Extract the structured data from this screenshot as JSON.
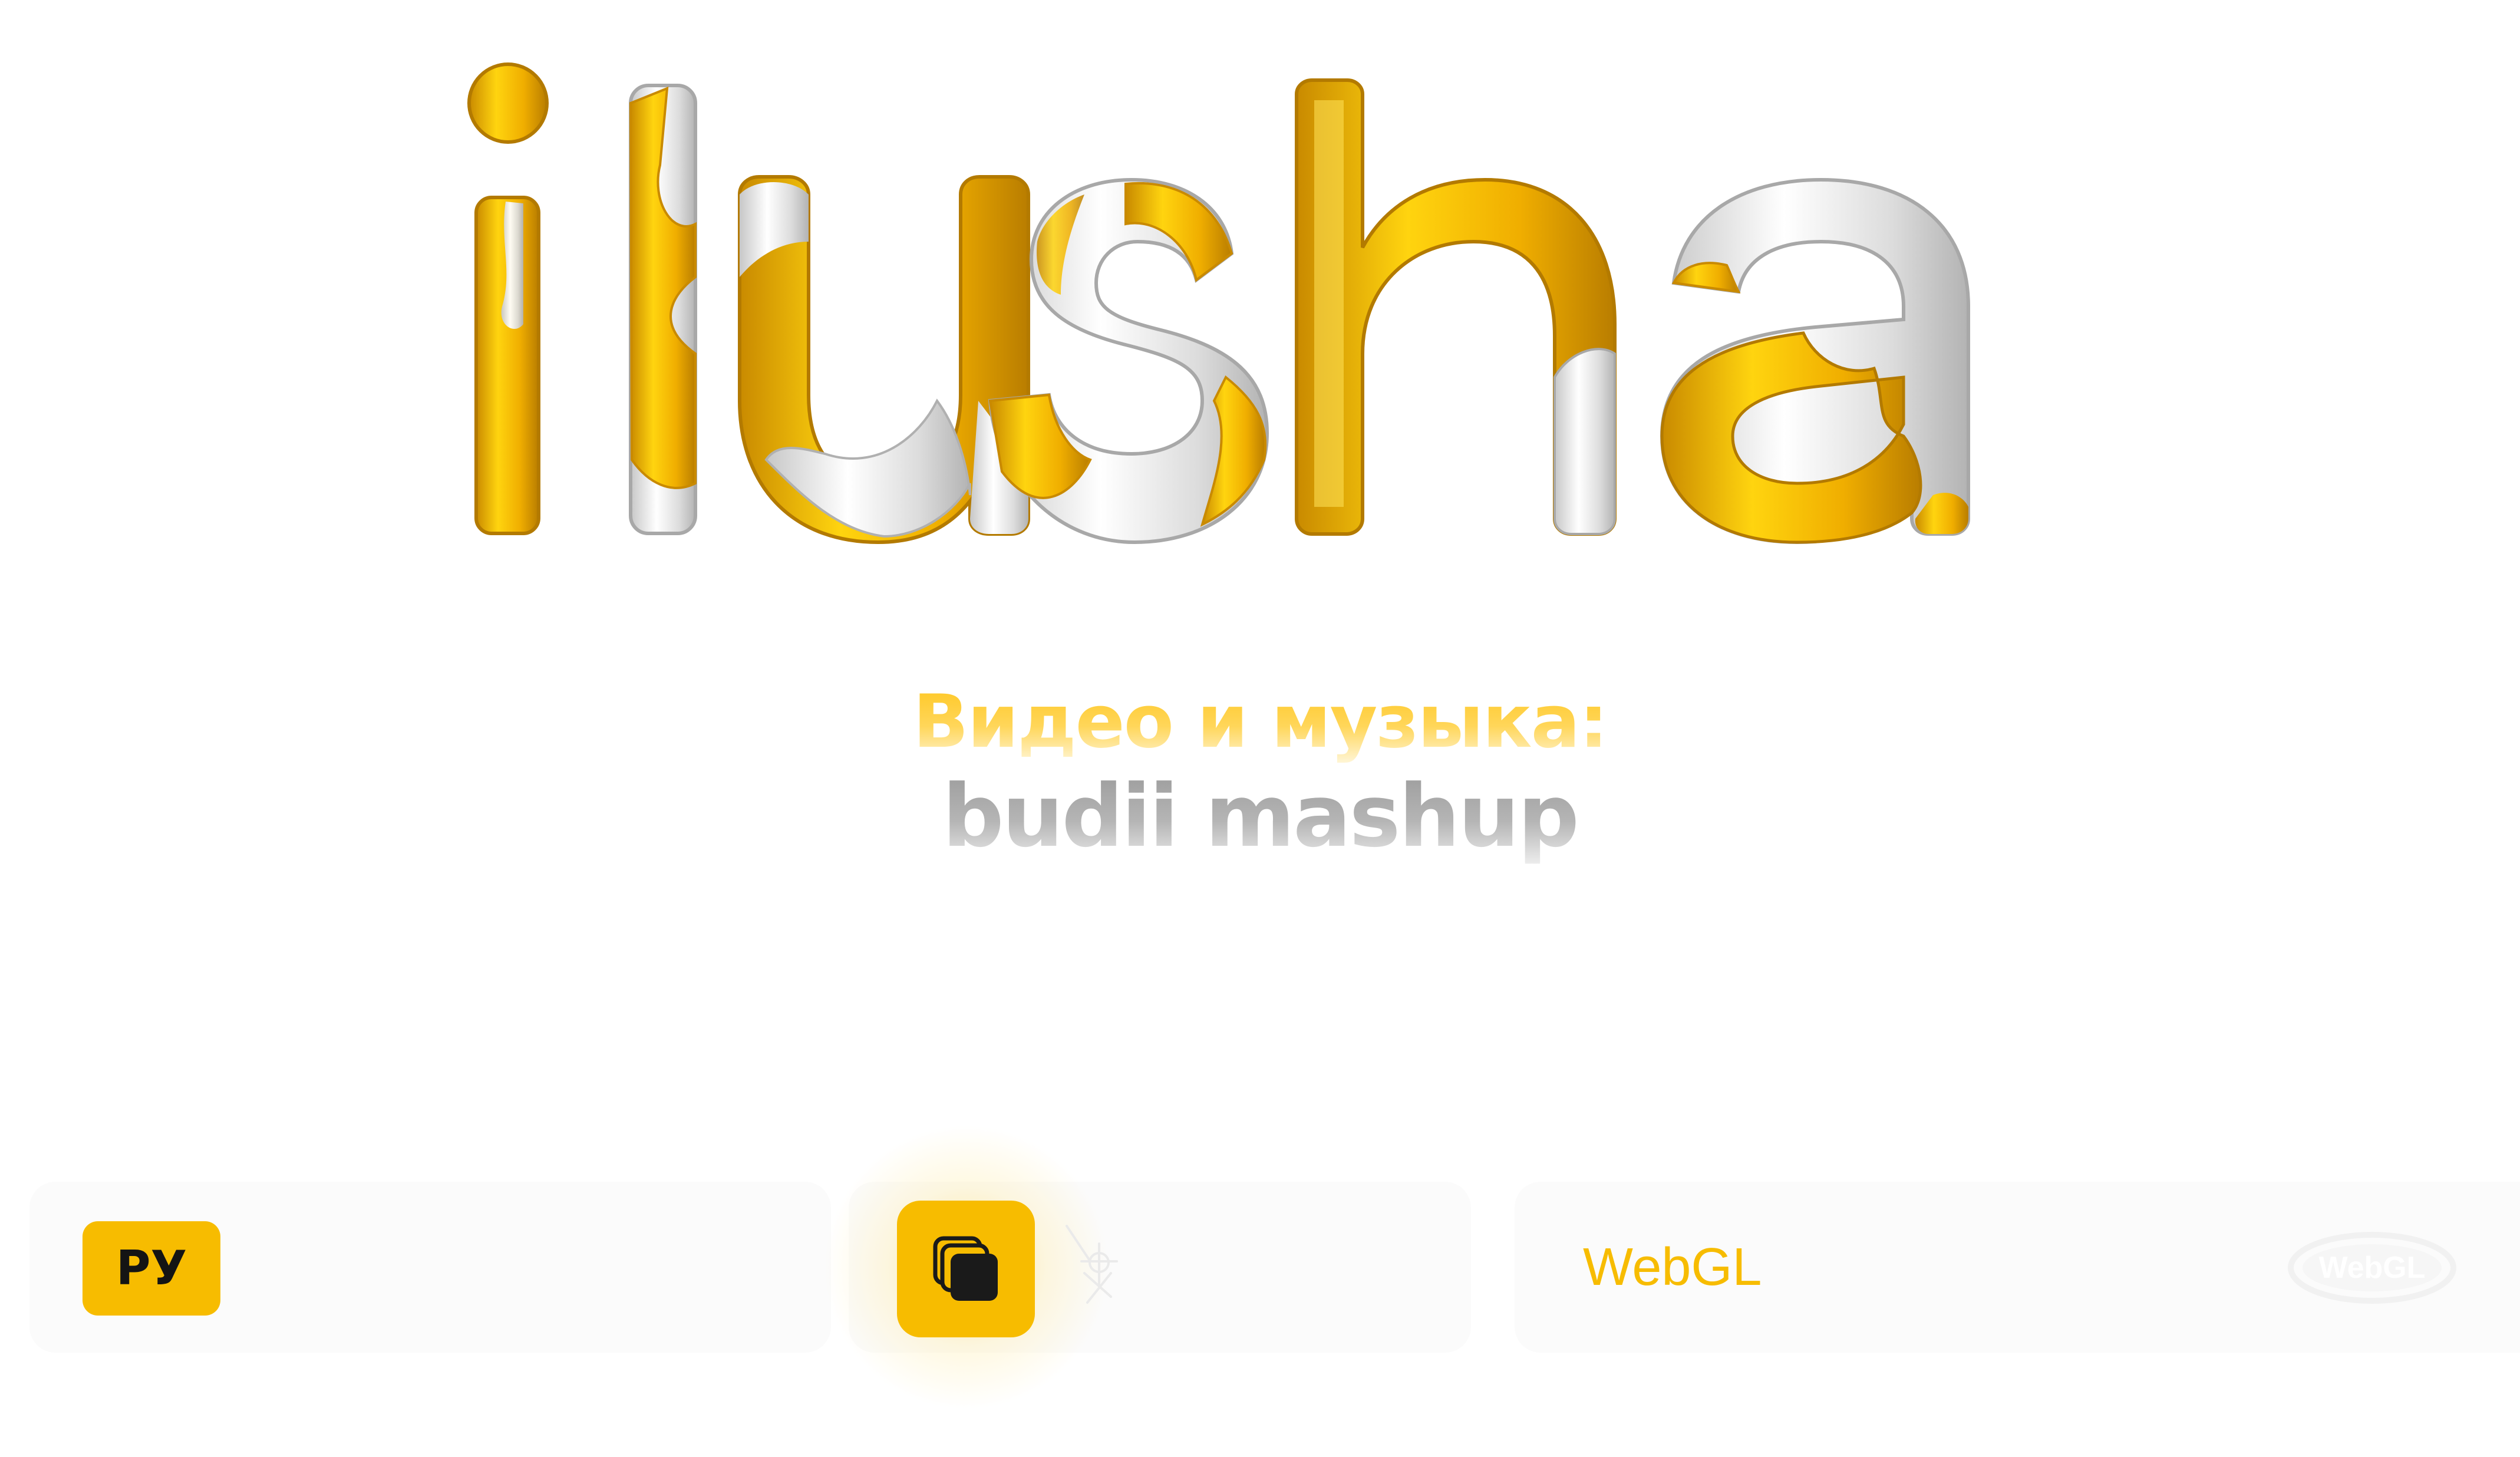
{
  "hero": {
    "logo_text": "ilusha"
  },
  "credits": {
    "label": "Видео и музыка:",
    "name": "budii mashup"
  },
  "toolbar": {
    "language_button": "РУ",
    "gallery_icon": "stacked-cards-icon",
    "renderer_label": "WebGL",
    "renderer_badge": "WebGL"
  },
  "colors": {
    "accent": "#f7bc00",
    "gold": "#ffc51a",
    "silver": "#d8d8d8",
    "panel_bg": "#fbfbfb",
    "dark_text": "#141414"
  }
}
